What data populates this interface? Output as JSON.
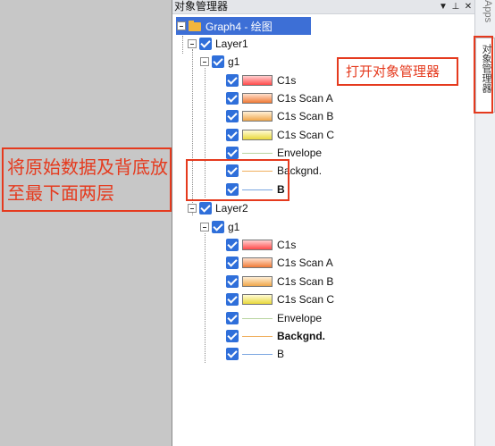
{
  "window": {
    "title": "对象管理器"
  },
  "titlebar_icons": [
    "dropdown-icon",
    "pin-icon",
    "close-icon"
  ],
  "tree": {
    "root_label": "Graph4 - 绘图",
    "layer1": {
      "label": "Layer1",
      "group": "g1",
      "items": [
        "C1s",
        "C1s Scan A",
        "C1s Scan B",
        "C1s Scan C",
        "Envelope",
        "Backgnd.",
        "B"
      ]
    },
    "layer2": {
      "label": "Layer2",
      "group": "g1",
      "items": [
        "C1s",
        "C1s Scan A",
        "C1s Scan B",
        "C1s Scan C",
        "Envelope",
        "Backgnd.",
        "B"
      ]
    }
  },
  "side_tabs": {
    "apps": "Apps",
    "object_manager": "对象管理器"
  },
  "annotations": {
    "left_note": "将原始数据及背底放至最下面两层",
    "right_note": "打开对象管理器"
  },
  "colors": {
    "selection": "#3d6fd6",
    "checkbox": "#2f6fda",
    "annotation_red": "#e53a1e"
  }
}
